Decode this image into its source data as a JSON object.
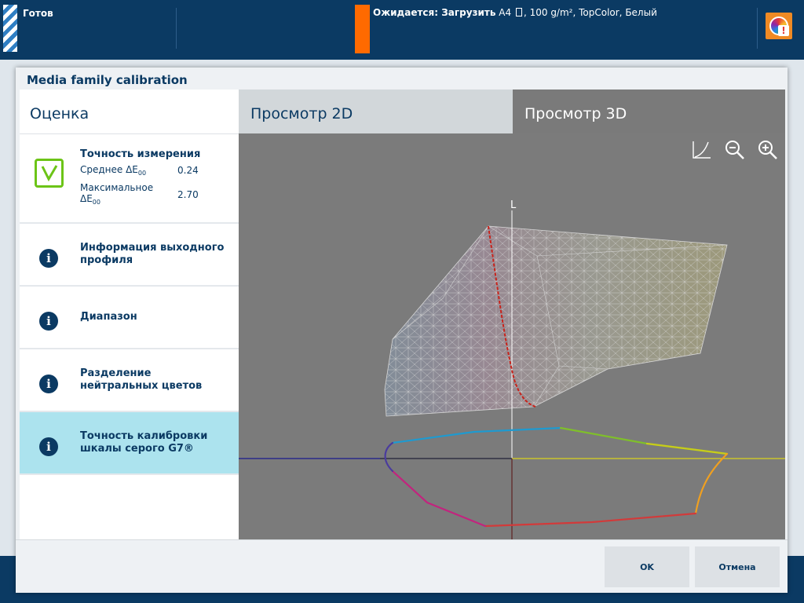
{
  "topbar": {
    "status": "Готов",
    "job_label": "Ожидается: Загрузить",
    "job_media": "A4",
    "job_details": ", 100 g/m², TopColor, Белый",
    "accent": "#ff6a00"
  },
  "dialog": {
    "title": "Media family calibration",
    "left_header": "Оценка",
    "measurement": {
      "title": "Точность измерения",
      "avg_label": "Среднее ΔE",
      "avg_sub": "00",
      "avg_value": "0.24",
      "max_label_1": "Максимальное",
      "max_label_2": "ΔE",
      "max_sub": "00",
      "max_value": "2.70",
      "status_icon": "check-icon",
      "status_color": "#6cc417"
    },
    "items": [
      {
        "label": "Информация выходного профиля",
        "icon": "info-icon"
      },
      {
        "label": "Диапазон",
        "icon": "info-icon"
      },
      {
        "label": "Разделение нейтральных цветов",
        "icon": "info-icon"
      },
      {
        "label": "Точность калибровки шкалы серого G7®",
        "icon": "info-icon",
        "selected": true
      }
    ],
    "tabs": [
      {
        "label": "Просмотр 2D",
        "active": false
      },
      {
        "label": "Просмотр 3D",
        "active": true
      }
    ],
    "viewer": {
      "axis_label": "L",
      "tools": [
        "curve-icon",
        "zoom-out-icon",
        "zoom-in-icon"
      ]
    },
    "buttons": {
      "ok": "OK",
      "cancel": "Отмена"
    }
  }
}
